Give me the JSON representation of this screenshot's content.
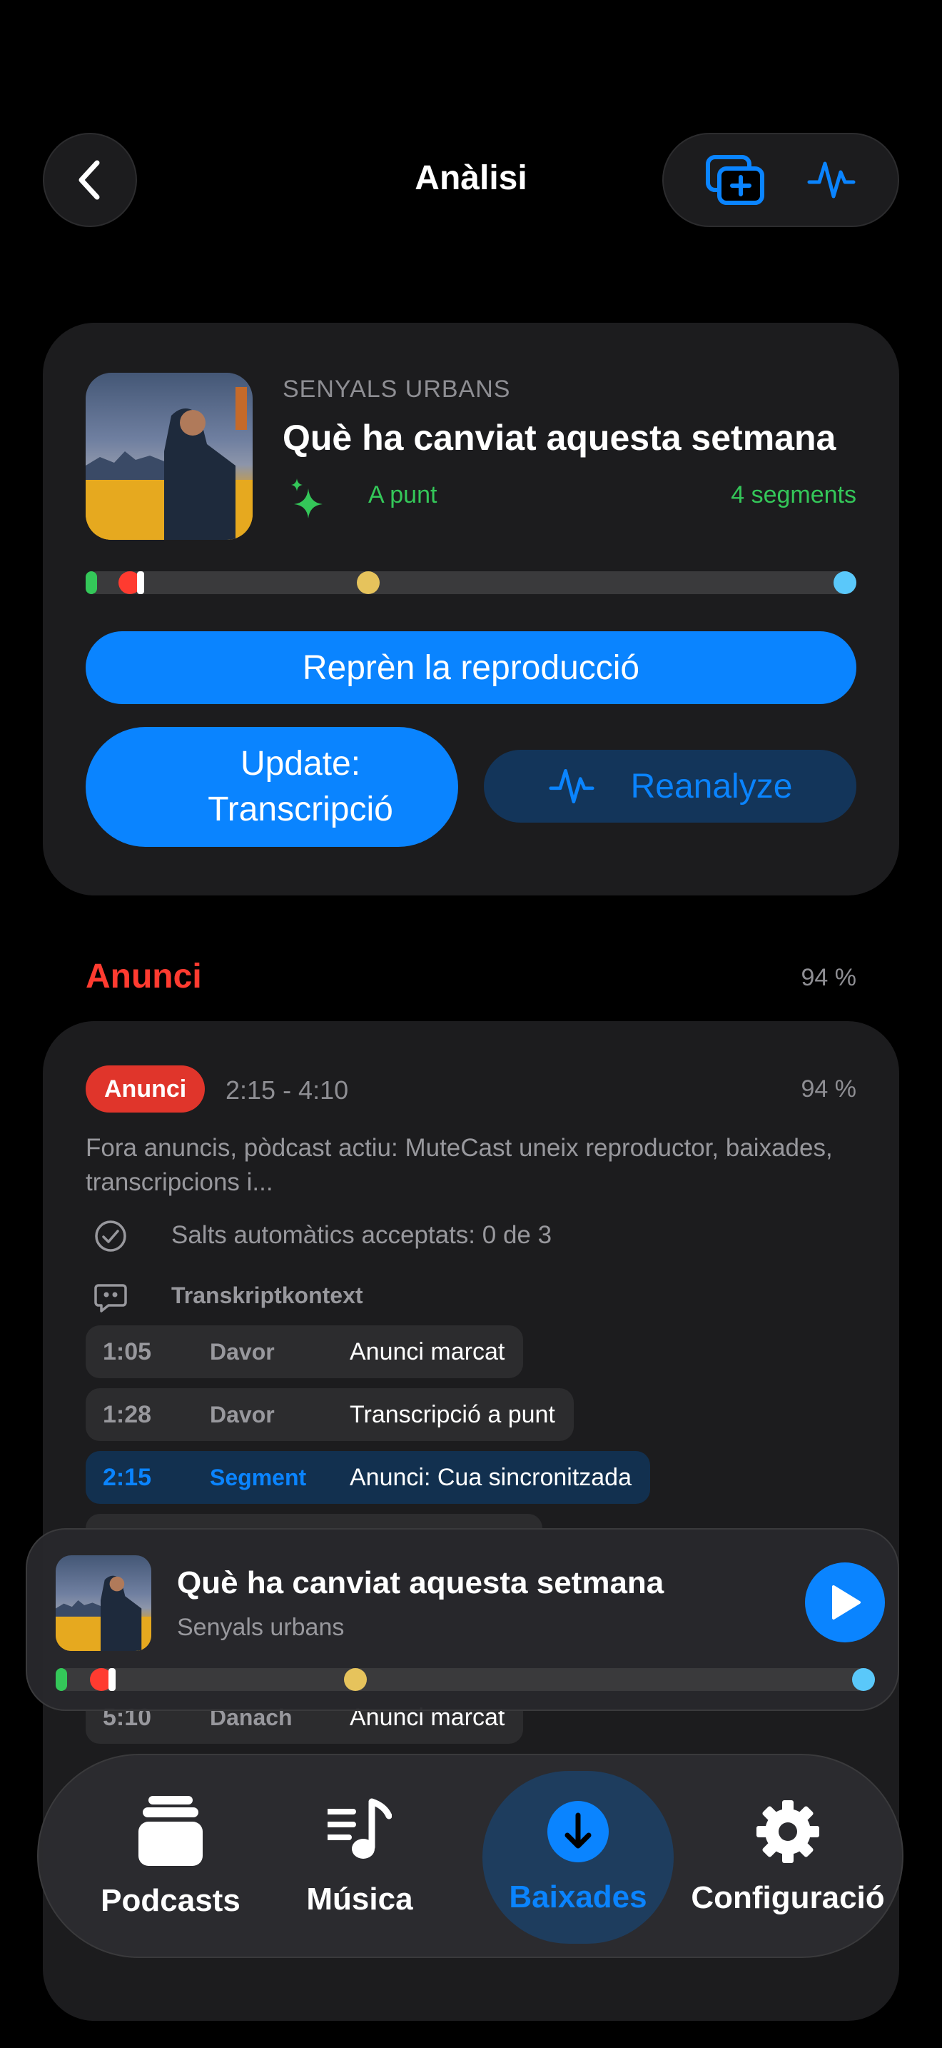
{
  "header": {
    "title": "Anàlisi",
    "back_icon": "chevron-left-icon",
    "actions": [
      "add-to-queue-icon",
      "waveform-icon"
    ]
  },
  "episode": {
    "show": "SENYALS URBANS",
    "title": "Què ha canviat aquesta setmana",
    "status": "A punt",
    "segments": "4 segments",
    "resume_label": "Reprèn la reproducció",
    "update_label_line1": "Update:",
    "update_label_line2": "Transcripció",
    "reanalyze_label": "Reanalyze"
  },
  "section": {
    "title": "Anunci",
    "confidence": "94 %"
  },
  "segment": {
    "badge": "Anunci",
    "time_range": "2:15 - 4:10",
    "confidence": "94 %",
    "description": "Fora anuncis, pòdcast actiu: MuteCast uneix reproductor, baixades, transcripcions i...",
    "auto_skips": "Salts automàtics acceptats: 0 de 3",
    "context_title": "Transkriptkontext",
    "context_rows": [
      {
        "time": "1:05",
        "kind": "Davor",
        "text": "Anunci marcat"
      },
      {
        "time": "1:28",
        "kind": "Davor",
        "text": "Transcripció a punt"
      },
      {
        "time": "2:15",
        "kind": "Segment",
        "text": "Anunci: Cua sincronitzada"
      },
      {
        "time": "5:10",
        "kind": "Danach",
        "text": "Anunci marcat"
      }
    ]
  },
  "mini_player": {
    "title": "Què ha canviat aquesta setmana",
    "show": "Senyals urbans",
    "play_icon": "play-icon"
  },
  "tabs": [
    {
      "label": "Podcasts",
      "icon": "podcasts-stack-icon"
    },
    {
      "label": "Música",
      "icon": "music-list-icon"
    },
    {
      "label": "Baixades",
      "icon": "download-icon",
      "active": true
    },
    {
      "label": "Configuració",
      "icon": "gear-icon"
    }
  ],
  "colors": {
    "accent": "#0a84ff",
    "ad": "#ff3b30",
    "ready": "#34c759",
    "marker_yellow": "#e6c35c",
    "marker_cyan": "#5ac8fa"
  }
}
